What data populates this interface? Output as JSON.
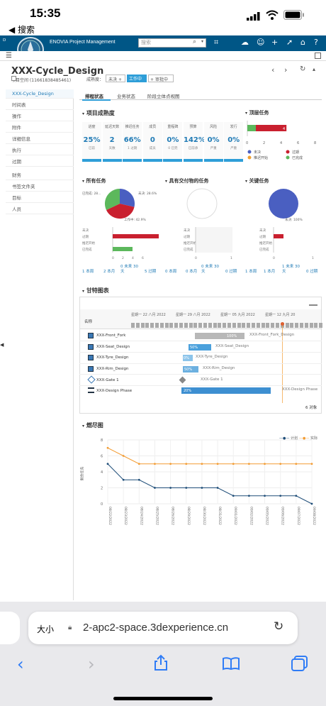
{
  "status": {
    "time": "15:35",
    "back": "◀ 搜索"
  },
  "app": {
    "brand": "ENOVIA Project Management",
    "search_placeholder": "搜索",
    "logo_text": "VR"
  },
  "header": {
    "title": "XXX-Cycle_Design",
    "space": "项目空间 (11661838485461)",
    "stage_label": "成熟度：",
    "stage_prev": "未决",
    "stage_current": "工作中",
    "stage_next": "审批中"
  },
  "sidebar": {
    "items": [
      "XXX-Cycle_Design",
      "时间表",
      "操作",
      "附件",
      "详细信息",
      "执行",
      "过期",
      "财务",
      "书签文件夹",
      "目标",
      "人员"
    ]
  },
  "tabs": [
    "排程状态",
    "业务状态",
    "阶段立体点视图"
  ],
  "maturity": {
    "title": "项目成熟度",
    "kpis": [
      {
        "label": "进度",
        "value": "25%",
        "sub": "已前"
      },
      {
        "label": "延迟天数",
        "value": "2",
        "sub": "天数"
      },
      {
        "label": "推迟任务",
        "value": "66%",
        "sub": "1 过期"
      },
      {
        "label": "成员",
        "value": "0",
        "sub": "成员"
      },
      {
        "label": "重程碑",
        "value": "0%",
        "sub": "0 已完"
      },
      {
        "label": "预算",
        "value": "142%",
        "sub": "已前承"
      },
      {
        "label": "风险",
        "value": "0%",
        "sub": "严重"
      },
      {
        "label": "发行",
        "value": "0%",
        "sub": "严重"
      }
    ]
  },
  "top_tasks": {
    "title": "顶层任务",
    "ticks": [
      "0",
      "2",
      "4",
      "6",
      "8"
    ],
    "legend": [
      "未决",
      "过期",
      "推迟开始",
      "已完成"
    ],
    "bar_value": "4",
    "bar_max": 8,
    "segments": [
      {
        "color": "#5cb85c",
        "value": 1
      },
      {
        "color": "#c9202f",
        "value": 3.6
      }
    ],
    "colors": {
      "pending": "#4a5fc1",
      "overdue": "#c9202f",
      "late": "#f0a030",
      "done": "#5cb85c"
    }
  },
  "all_tasks": {
    "title": "所有任务",
    "label_done": "已完成: 28...",
    "label_pending": "未决: 28.6%",
    "label_work": "工作中: 42.9%",
    "rows": [
      "未决",
      "过期",
      "推迟开始",
      "已完成"
    ],
    "row_values": [
      0,
      5.2,
      0,
      2
    ],
    "ticks": [
      "0",
      "2",
      "4",
      "6"
    ],
    "links": [
      {
        "n": "1",
        "t": "本周"
      },
      {
        "n": "2",
        "t": "本月"
      },
      {
        "n": "0",
        "t": "未来 30 天"
      },
      {
        "n": "5",
        "t": "过期"
      }
    ]
  },
  "deliverables": {
    "title": "具有交付物的任务",
    "rows": [
      "未决",
      "过期",
      "推迟开始",
      "已完成"
    ],
    "ticks": [
      "0",
      "1"
    ],
    "links": [
      {
        "n": "0",
        "t": "本周"
      },
      {
        "n": "0",
        "t": "本月"
      },
      {
        "n": "0",
        "t": "未来 30 天"
      },
      {
        "n": "0",
        "t": "过期"
      }
    ]
  },
  "key_tasks": {
    "title": "关键任务",
    "label_pending": "未决: 100%",
    "rows": [
      "未决",
      "过期",
      "推迟开始",
      "已完成"
    ],
    "row_values": [
      0,
      1,
      0,
      0
    ],
    "ticks": [
      "0",
      "1"
    ],
    "links": [
      {
        "n": "1",
        "t": "本周"
      },
      {
        "n": "1",
        "t": "本月"
      },
      {
        "n": "1",
        "t": "未来 30 天"
      },
      {
        "n": "0",
        "t": "过期"
      }
    ]
  },
  "gantt": {
    "title": "甘特图表",
    "col_name": "名称",
    "weeks": [
      "星期一 22 八月 2022",
      "星期一 29 八月 2022",
      "星期一 05 九月 2022",
      "星期一 12 九月 20"
    ],
    "rows": [
      {
        "name": "XXX-Front_Fork",
        "task": "XXX-Front_Fork_Design",
        "pct": "100%"
      },
      {
        "name": "XXX-Seat_Design",
        "task": "XXX-Seat_Design",
        "pct": "50%"
      },
      {
        "name": "XXX-Tyre_Design",
        "task": "XXX-Tyre_Design",
        "pct": "0%"
      },
      {
        "name": "XXX-Rim_Design",
        "task": "XXX-Rim_Design",
        "pct": "50%"
      },
      {
        "name": "XXX-Gate 1",
        "task": "XXX-Gate 1",
        "pct": ""
      },
      {
        "name": "XXX-Design Phase",
        "task": "XXX-Design Phase",
        "pct": "20%"
      }
    ],
    "count": "6 对象"
  },
  "burndown": {
    "title": "燃尽图",
    "legend": [
      "计划",
      "实际"
    ],
    "ylabel": "剩余任务",
    "chart_data": {
      "type": "line",
      "x": [
        "08/22/2022",
        "08/23/2022",
        "08/24/2022",
        "08/25/2022",
        "08/26/2022",
        "08/29/2022",
        "08/30/2022",
        "08/31/2022",
        "09/01/2022",
        "09/02/2022",
        "09/05/2022",
        "09/06/2022",
        "09/07/2022",
        "09/08/2022"
      ],
      "series": [
        {
          "name": "计划",
          "color": "#1f4e79",
          "values": [
            5,
            3,
            3,
            2,
            2,
            2,
            2,
            2,
            1,
            1,
            1,
            1,
            1,
            0
          ]
        },
        {
          "name": "实际",
          "color": "#f39c33",
          "values": [
            7,
            6,
            5,
            5,
            5,
            5,
            5,
            5,
            5,
            5,
            5,
            5,
            5,
            5
          ]
        }
      ],
      "ylim": [
        0,
        8
      ],
      "yticks": [
        0,
        2,
        4,
        6,
        8
      ]
    }
  },
  "safari": {
    "aa": "大小",
    "url": "2-apc2-space.3dexperience.cn"
  }
}
